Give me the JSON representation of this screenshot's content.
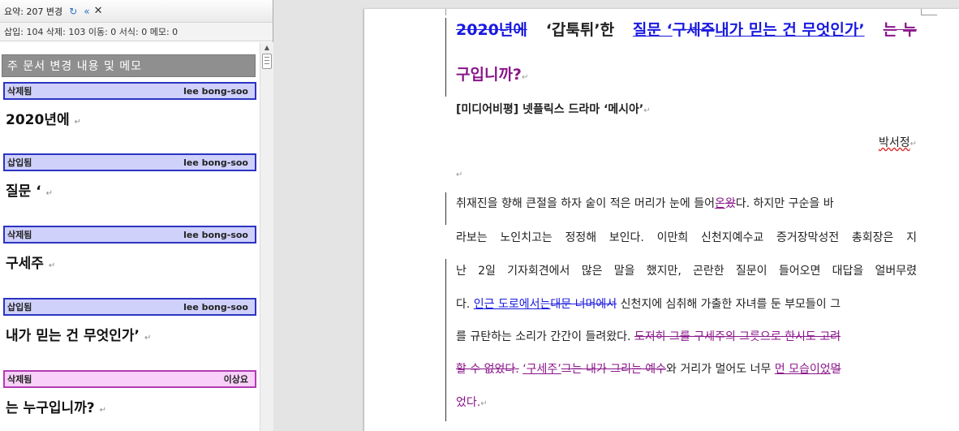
{
  "pane": {
    "summary": "요약: 207 변경",
    "stats": "삽입: 104 삭제: 103 이동: 0 서식: 0 메모: 0",
    "section_title": "주 문서 변경 내용 및 메모",
    "revisions": [
      {
        "type": "삭제됨",
        "author": "lee bong-soo",
        "text": "2020년에"
      },
      {
        "type": "삽입됨",
        "author": "lee bong-soo",
        "text": "질문 ‘"
      },
      {
        "type": "삭제됨",
        "author": "lee bong-soo",
        "text": "구세주"
      },
      {
        "type": "삽입됨",
        "author": "lee bong-soo",
        "text": "내가 믿는 건 무엇인가’"
      },
      {
        "type": "삭제됨",
        "author": "이상요",
        "text": "는 누구입니까?"
      }
    ]
  },
  "doc": {
    "title_deleted1": "2020년에",
    "title_quote": "‘갑툭튀’한",
    "title_ins1": "질문 ‘",
    "title_deleted2": "구세주",
    "title_ins2": "내가 믿는 건 무엇인가’",
    "title_deleted3a": "는 누",
    "title_deleted3b": "구입니까?",
    "subtitle": "[미디어비평] 넷플릭스 드라마 ‘메시아’",
    "author": "박서정",
    "p1": [
      "취재진을 향해 큰절을 하자 숱이 적은 머리가 눈에 들어",
      "온",
      "왔",
      "다. 하지만 구순을 바"
    ],
    "p2": "라보는 노인치고는 정정해 보인다. 이만희 신천지예수교 증거장막성전 총회장은 지",
    "p3": "난 2일 기자회견에서 많은 말을 했지만, 곤란한 질문이 들어오면 대답을 얼버무렸",
    "p4": [
      "다. ",
      "인근 도로에서는",
      "대문 너머에서",
      " 신천지에 심취해 가출한 자녀를 둔 부모들이 그"
    ],
    "p5": [
      "를 규탄하는 소리가 간간이 들려왔다. ",
      "도저히 그를 구세주의 그릇으로 한시도 고려"
    ],
    "p6": [
      "할 수 없었다.",
      " ",
      "‘구세주’",
      "그는 내가 그리는 예수",
      "와 거리가 멀어도 너무 ",
      "먼 모습이었",
      "멀"
    ],
    "p7": "었다."
  },
  "colors": {
    "insert_blue": "#1a1ae0",
    "delete_purple": "#8a168a",
    "header_blue_bg": "#cfd1fb",
    "header_pink_bg": "#f8d0f9"
  }
}
